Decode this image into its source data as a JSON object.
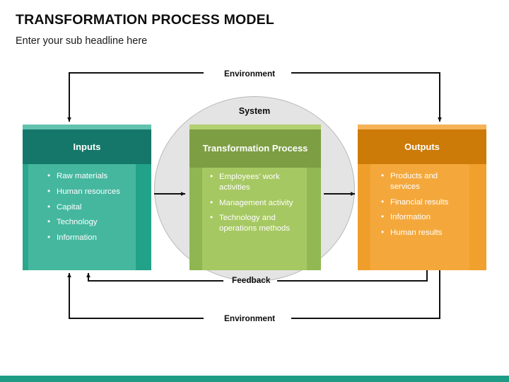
{
  "header": {
    "title": "TRANSFORMATION PROCESS MODEL",
    "subtitle": "Enter your sub headline here"
  },
  "diagram": {
    "system_label": "System",
    "connectors": {
      "environment_top": "Environment",
      "feedback": "Feedback",
      "environment_bottom": "Environment"
    },
    "panels": [
      {
        "id": "inputs",
        "title": "Inputs",
        "accent": "#15776a",
        "body_color": "#45b79f",
        "items": [
          "Raw materials",
          "Human resources",
          "Capital",
          "Technology",
          "Information"
        ]
      },
      {
        "id": "transformation",
        "title": "Transformation Process",
        "accent": "#7d9e43",
        "body_color": "#a6c862",
        "items": [
          "Employees’ work activities",
          "Management activity",
          "Technology and operations methods"
        ]
      },
      {
        "id": "outputs",
        "title": "Outputs",
        "accent": "#cc7a08",
        "body_color": "#f4a83c",
        "items": [
          "Products and services",
          "Financial results",
          "Information",
          "Human results"
        ]
      }
    ]
  },
  "footer": {
    "bar_color": "#1f9c85"
  }
}
